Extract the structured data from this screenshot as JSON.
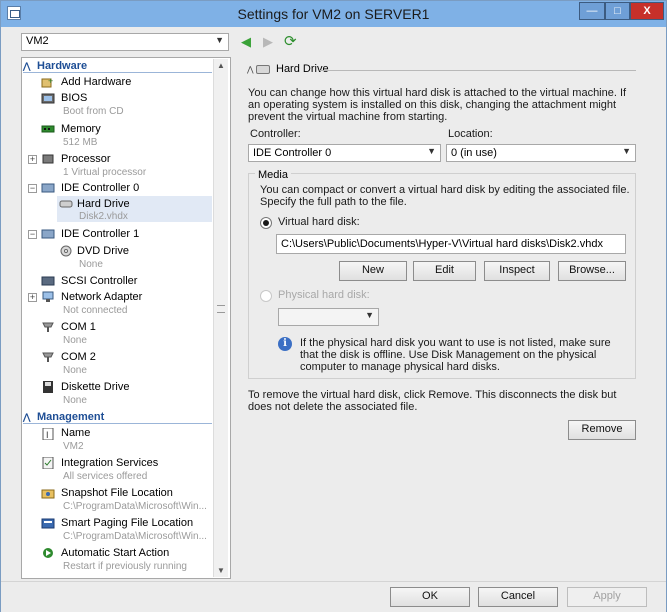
{
  "window": {
    "title": "Settings for VM2 on SERVER1",
    "buttons": {
      "minimize": "—",
      "maximize": "□",
      "close": "X"
    }
  },
  "vm_selector": {
    "value": "VM2"
  },
  "sidebar": {
    "hardware_header": "Hardware",
    "management_header": "Management",
    "items": {
      "add_hardware": {
        "label": "Add Hardware"
      },
      "bios": {
        "label": "BIOS",
        "sub": "Boot from CD"
      },
      "memory": {
        "label": "Memory",
        "sub": "512 MB"
      },
      "processor": {
        "label": "Processor",
        "sub": "1 Virtual processor"
      },
      "ide0": {
        "label": "IDE Controller 0"
      },
      "hard_drive": {
        "label": "Hard Drive",
        "sub": "Disk2.vhdx"
      },
      "ide1": {
        "label": "IDE Controller 1"
      },
      "dvd": {
        "label": "DVD Drive",
        "sub": "None"
      },
      "scsi": {
        "label": "SCSI Controller"
      },
      "network": {
        "label": "Network Adapter",
        "sub": "Not connected"
      },
      "com1": {
        "label": "COM 1",
        "sub": "None"
      },
      "com2": {
        "label": "COM 2",
        "sub": "None"
      },
      "diskette": {
        "label": "Diskette Drive",
        "sub": "None"
      },
      "name": {
        "label": "Name",
        "sub": "VM2"
      },
      "integration": {
        "label": "Integration Services",
        "sub": "All services offered"
      },
      "snapshot": {
        "label": "Snapshot File Location",
        "sub": "C:\\ProgramData\\Microsoft\\Win..."
      },
      "paging": {
        "label": "Smart Paging File Location",
        "sub": "C:\\ProgramData\\Microsoft\\Win..."
      },
      "autostart": {
        "label": "Automatic Start Action",
        "sub": "Restart if previously running"
      }
    }
  },
  "panel": {
    "title": "Hard Drive",
    "description": "You can change how this virtual hard disk is attached to the virtual machine. If an operating system is installed on this disk, changing the attachment might prevent the virtual machine from starting.",
    "controller_label": "Controller:",
    "controller_value": "IDE Controller 0",
    "location_label": "Location:",
    "location_value": "0 (in use)",
    "media_label": "Media",
    "media_description": "You can compact or convert a virtual hard disk by editing the associated file. Specify the full path to the file.",
    "virtual_disk_label": "Virtual hard disk:",
    "virtual_disk_path": "C:\\Users\\Public\\Documents\\Hyper-V\\Virtual hard disks\\Disk2.vhdx",
    "new_button": "New",
    "edit_button": "Edit",
    "inspect_button": "Inspect",
    "browse_button": "Browse...",
    "physical_disk_label": "Physical hard disk:",
    "physical_disk_value": "",
    "info_text": "If the physical hard disk you want to use is not listed, make sure that the disk is offline. Use Disk Management on the physical computer to manage physical hard disks.",
    "remove_text": "To remove the virtual hard disk, click Remove. This disconnects the disk but does not delete the associated file.",
    "remove_button": "Remove"
  },
  "footer": {
    "ok": "OK",
    "cancel": "Cancel",
    "apply": "Apply"
  }
}
